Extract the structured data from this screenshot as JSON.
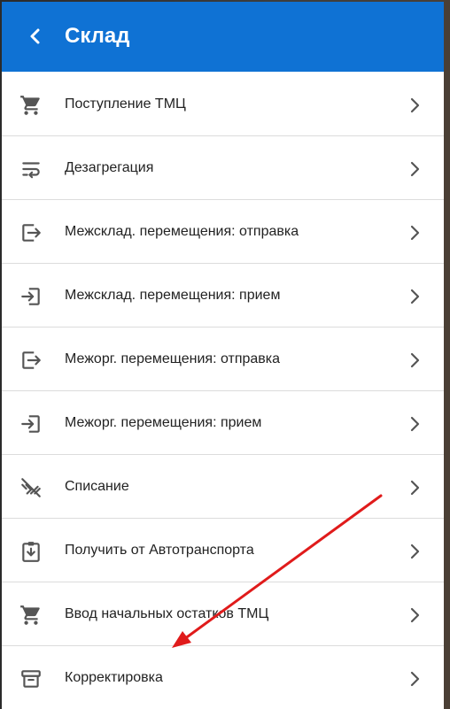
{
  "header": {
    "title": "Склад"
  },
  "menu": {
    "items": [
      {
        "label": "Поступление ТМЦ",
        "icon": "cart-icon"
      },
      {
        "label": "Дезагрегация",
        "icon": "wrap-text-icon"
      },
      {
        "label": "Межсклад. перемещения: отправка",
        "icon": "exit-to-app-icon"
      },
      {
        "label": "Межсклад. перемещения: прием",
        "icon": "enter-icon"
      },
      {
        "label": "Межорг. перемещения: отправка",
        "icon": "exit-to-app-icon"
      },
      {
        "label": "Межорг. перемещения: прием",
        "icon": "enter-icon"
      },
      {
        "label": "Списание",
        "icon": "write-off-icon"
      },
      {
        "label": "Получить от Автотранспорта",
        "icon": "clipboard-download-icon"
      },
      {
        "label": "Ввод начальных остатков ТМЦ",
        "icon": "cart-icon"
      },
      {
        "label": "Корректировка",
        "icon": "archive-icon"
      }
    ]
  },
  "colors": {
    "appbar": "#0f72d4",
    "annotation_arrow": "#e01b1b"
  }
}
